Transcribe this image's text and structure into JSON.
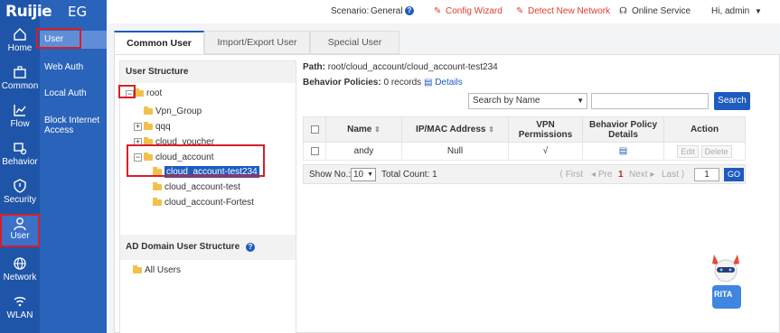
{
  "app": {
    "brand": "Ruijie",
    "model": "EG"
  },
  "rail": [
    {
      "key": "home",
      "label": "Home"
    },
    {
      "key": "common",
      "label": "Common"
    },
    {
      "key": "flow",
      "label": "Flow"
    },
    {
      "key": "behavior",
      "label": "Behavior"
    },
    {
      "key": "security",
      "label": "Security"
    },
    {
      "key": "user",
      "label": "User"
    },
    {
      "key": "network",
      "label": "Network"
    },
    {
      "key": "wlan",
      "label": "WLAN"
    }
  ],
  "subnav": [
    "User",
    "Web Auth",
    "Local Auth",
    "Block Internet Access"
  ],
  "topbar": {
    "scenario_label": "Scenario:",
    "scenario_value": "General",
    "config_wizard": "Config Wizard",
    "detect_network": "Detect New Network",
    "online_service": "Online Service",
    "greeting": "Hi, admin"
  },
  "tabs": [
    "Common User",
    "Import/Export User",
    "Special User"
  ],
  "user_structure": {
    "title": "User Structure",
    "nodes": [
      "root",
      "Vpn_Group",
      "qqq",
      "cloud_voucher",
      "cloud_account",
      "cloud_account-test234",
      "cloud_account-test",
      "cloud_account-Fortest"
    ]
  },
  "ad_structure": {
    "title": "AD Domain User Structure",
    "nodes": [
      "All Users"
    ]
  },
  "path": {
    "label": "Path:",
    "value": "root/cloud_account/cloud_account-test234"
  },
  "policies": {
    "label": "Behavior Policies:",
    "value": "0 records",
    "details": "Details"
  },
  "search": {
    "select_value": "Search by Name",
    "input_value": "",
    "button": "Search"
  },
  "table": {
    "headers": [
      "Name",
      "IP/MAC Address",
      "VPN Permissions",
      "Behavior Policy Details",
      "Action"
    ],
    "rows": [
      {
        "name": "andy",
        "ip": "Null",
        "vpn": "√",
        "edit": "Edit",
        "delete": "Delete"
      }
    ]
  },
  "pager": {
    "show_no_label": "Show No.:",
    "show_no_value": "10",
    "total": "Total Count: 1",
    "first": "First",
    "prev": "Pre",
    "current": "1",
    "next": "Next",
    "last": "Last",
    "page_input": "1",
    "go": "GO"
  },
  "colors": {
    "rail": "#1f55a8",
    "subnav": "#2a63ba",
    "accent": "#1e5bbf",
    "highlight": "#d71f28",
    "red_link": "#e23b2e"
  },
  "mascot": {
    "label": "RITA"
  }
}
